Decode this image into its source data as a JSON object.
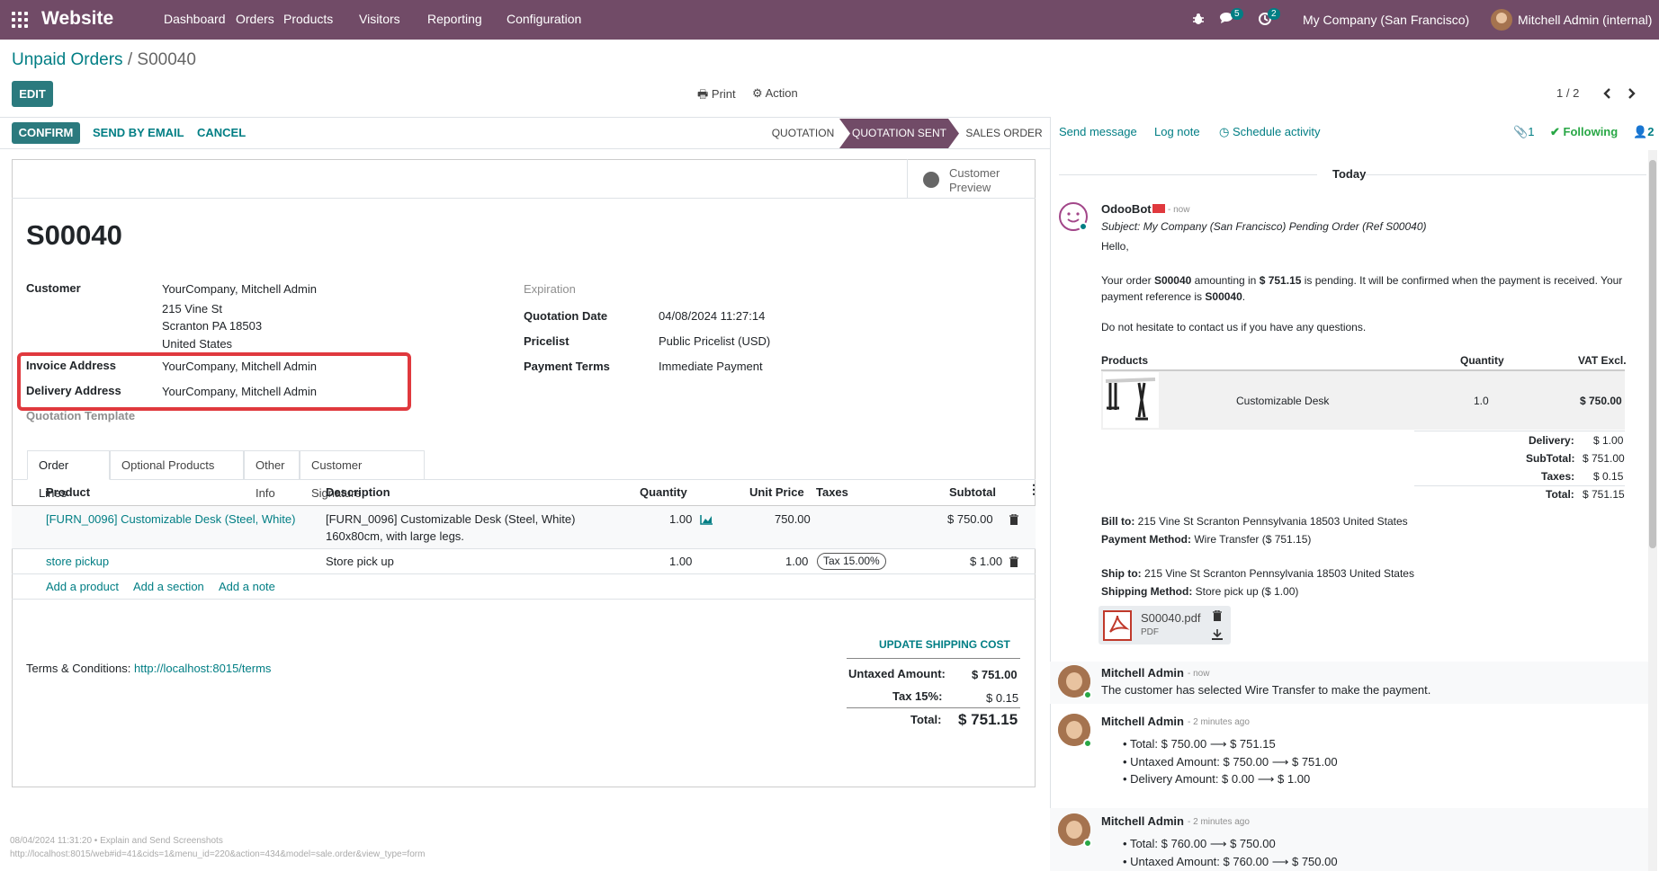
{
  "navbar": {
    "brand": "Website",
    "menus": [
      "Dashboard",
      "Orders",
      "Products",
      "Visitors",
      "Reporting",
      "Configuration"
    ],
    "messages_count": "5",
    "activities_count": "2",
    "company": "My Company (San Francisco)",
    "user": "Mitchell Admin (internal)",
    "bg_color": "#714b67"
  },
  "control": {
    "breadcrumb_parent": "Unpaid Orders",
    "breadcrumb_sep": " / ",
    "breadcrumb_current": "S00040",
    "edit_label": "EDIT",
    "print_label": "Print",
    "action_label": "Action",
    "pager": "1 / 2"
  },
  "statusbar": {
    "confirm_label": "CONFIRM",
    "send_email_label": "SEND BY EMAIL",
    "cancel_label": "CANCEL",
    "stages": [
      "QUOTATION",
      "QUOTATION SENT",
      "SALES ORDER"
    ],
    "active_stage": "QUOTATION SENT"
  },
  "form": {
    "customer_preview": [
      "Customer",
      "Preview"
    ],
    "title": "S00040",
    "customer_label": "Customer",
    "customer_name": "YourCompany, Mitchell Admin",
    "address_lines": [
      "215 Vine St",
      "Scranton PA 18503",
      "United States"
    ],
    "invoice_label": "Invoice Address",
    "invoice_value": "YourCompany, Mitchell Admin",
    "delivery_label": "Delivery Address",
    "delivery_value": "YourCompany, Mitchell Admin",
    "template_label": "Quotation Template",
    "expiration_label": "Expiration",
    "quotation_date_label": "Quotation Date",
    "quotation_date": "04/08/2024 11:27:14",
    "pricelist_label": "Pricelist",
    "pricelist": "Public Pricelist (USD)",
    "payment_terms_label": "Payment Terms",
    "payment_terms": "Immediate Payment",
    "highlight_color": "#e0393e"
  },
  "tabs": [
    "Order Lines",
    "Optional Products",
    "Other Info",
    "Customer Signature"
  ],
  "table": {
    "headers": [
      "Product",
      "Description",
      "Quantity",
      "Unit Price",
      "Taxes",
      "Subtotal"
    ],
    "rows": [
      {
        "product": "[FURN_0096] Customizable Desk (Steel, White)",
        "desc1": "[FURN_0096] Customizable Desk (Steel, White)",
        "desc2": "160x80cm, with large legs.",
        "qty": "1.00",
        "price": "750.00",
        "tax": "",
        "subtotal": "$ 750.00"
      },
      {
        "product": "store pickup",
        "desc1": "Store pick up",
        "desc2": "",
        "qty": "1.00",
        "price": "1.00",
        "tax": "Tax 15.00%",
        "subtotal": "$ 1.00"
      }
    ],
    "add_product": "Add a product",
    "add_section": "Add a section",
    "add_note": "Add a note"
  },
  "totals": {
    "update_shipping": "UPDATE SHIPPING COST",
    "untaxed_label": "Untaxed Amount:",
    "untaxed": "$ 751.00",
    "tax_label": "Tax 15%:",
    "tax": "$ 0.15",
    "total_label": "Total:",
    "total": "$ 751.15"
  },
  "terms": {
    "label": "Terms & Conditions:",
    "link": "http://localhost:8015/terms"
  },
  "footer": {
    "line1": "08/04/2024 11:31:20 • Explain and Send Screenshots",
    "line2": "http://localhost:8015/web#id=41&cids=1&menu_id=220&action=434&model=sale.order&view_type=form"
  },
  "chatter": {
    "send_message": "Send message",
    "log_note": "Log note",
    "schedule_activity": "Schedule activity",
    "attachments_count": "1",
    "following": "Following",
    "followers_count": "2",
    "today": "Today",
    "msg1": {
      "author": "OdooBot",
      "time": "- now",
      "subject": "Subject: My Company (San Francisco) Pending Order (Ref S00040)",
      "hello": "Hello,",
      "body_a": "Your order ",
      "body_b": "S00040",
      "body_c": " amounting in ",
      "body_d": "$ 751.15",
      "body_e": " is pending. It will be confirmed when the payment is received. Your",
      "body_f": "payment reference is ",
      "body_g": "S00040",
      "body_h": ".",
      "contact": "Do not hesitate to contact us if you have any questions.",
      "products_header": "Products",
      "quantity_header": "Quantity",
      "vat_header": "VAT Excl.",
      "product_name": "Customizable Desk",
      "product_qty": "1.0",
      "product_price": "$ 750.00",
      "summary": [
        {
          "label": "Delivery:",
          "value": "$ 1.00"
        },
        {
          "label": "SubTotal:",
          "value": "$ 751.00"
        },
        {
          "label": "Taxes:",
          "value": "$ 0.15"
        },
        {
          "label": "Total:",
          "value": "$ 751.15"
        }
      ],
      "bill_to_label": "Bill to:",
      "bill_to": " 215 Vine St Scranton Pennsylvania 18503 United States",
      "payment_method_label": "Payment Method:",
      "payment_method": " Wire Transfer ($ 751.15)",
      "ship_to_label": "Ship to:",
      "ship_to": " 215 Vine St Scranton Pennsylvania 18503 United States",
      "shipping_method_label": "Shipping Method:",
      "shipping_method": " Store pick up ($ 1.00)",
      "attachment_name": "S00040.pdf",
      "attachment_type": "PDF"
    },
    "msg2": {
      "author": "Mitchell Admin",
      "time": "- now",
      "text": "The customer has selected Wire Transfer to make the payment."
    },
    "msg3": {
      "author": "Mitchell Admin",
      "time": "- 2 minutes ago",
      "changes": [
        "Total: $ 750.00 ⟶ $ 751.15",
        "Untaxed Amount: $ 750.00 ⟶ $ 751.00",
        "Delivery Amount: $ 0.00 ⟶ $ 1.00"
      ]
    },
    "msg4": {
      "author": "Mitchell Admin",
      "time": "- 2 minutes ago",
      "changes": [
        "Total: $ 760.00 ⟶ $ 750.00",
        "Untaxed Amount: $ 760.00 ⟶ $ 750.00"
      ]
    }
  }
}
